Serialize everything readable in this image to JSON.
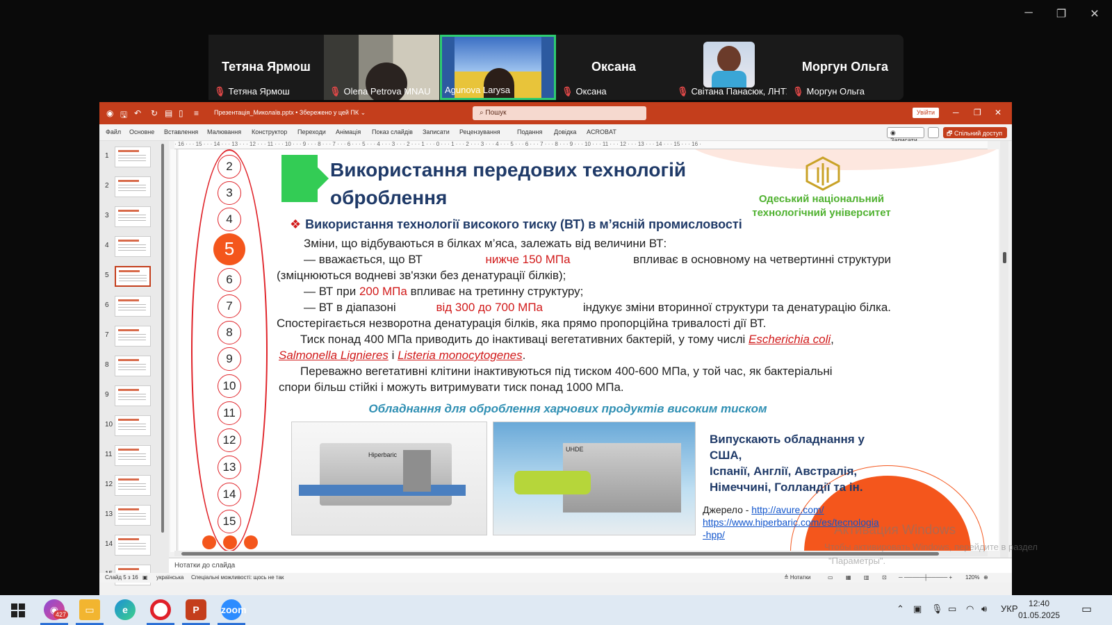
{
  "zoom": {
    "participants": [
      {
        "big_name": "Тетяна Ярмош",
        "label": "Тетяна Ярмош"
      },
      {
        "big_name": "",
        "label": "Olena Petrova MNAU"
      },
      {
        "big_name": "",
        "label": "Agunova Larysa"
      },
      {
        "big_name": "Оксана",
        "label": "Оксана"
      },
      {
        "big_name": "",
        "label": "Світана Панасюк, ЛНТУ"
      },
      {
        "big_name": "Моргун Ольга",
        "label": "Моргун Ольга"
      }
    ],
    "active_speaker_color": "#2ecc71"
  },
  "ppt": {
    "file_title": "Презентація_Миколаїв.pptx • Збережено у цей ПК ⌄",
    "search_placeholder": "Пошук",
    "login_label": "Увійти",
    "menu": [
      "Файл",
      "Основне",
      "Вставлення",
      "Малювання",
      "Конструктор",
      "Переходи",
      "Анімація",
      "Показ слайдів",
      "Записати",
      "Рецензування",
      "Подання",
      "Довідка",
      "ACROBAT"
    ],
    "record_label": "◉ Записати",
    "share_label": "🗗 Спільний доступ ⌄",
    "thumbnails": [
      "1",
      "2",
      "3",
      "4",
      "5",
      "6",
      "7",
      "8",
      "9",
      "10",
      "11",
      "12",
      "13",
      "14",
      "15"
    ],
    "selected_slide": 5,
    "ruler_text": "· 16 · · · 15 · · · 14 · · · 13 · · · 12 · · · 11 · · · 10 · · · 9 · · · 8 · · · 7 · · · 6 · · · 5 · · · 4 · · · 3 · · · 2 · · · 1 · · · 0 · · · 1 · · · 2 · · · 3 · · · 4 · · · 5 · · · 6 · · · 7 · · · 8 · · · 9 · · · 10 · · · 11 · · · 12 · · · 13 · · · 14 · · · 15 · · · 16 ·",
    "notes_placeholder": "Нотатки до слайда",
    "status": {
      "slide": "Слайд 5 з 16",
      "language": "українська",
      "accessibility": "Спеціальні можливості: щось не так",
      "notes_btn": "≜ Нотатки",
      "zoom": "120%"
    }
  },
  "slide": {
    "title_line1": "Використання передових технологій",
    "title_line2": "оброблення",
    "university_line1": "Одеський національний",
    "university_line2": "технологічний університет",
    "nav_numbers": [
      "2",
      "3",
      "4",
      "5",
      "6",
      "7",
      "8",
      "9",
      "10",
      "11",
      "12",
      "13",
      "14",
      "15"
    ],
    "active_number": "5",
    "heading": "Використання технології високого тиску (ВТ) в м’ясній промисловості",
    "p1": "Зміни, що відбуваються в білках м’яса, залежать від величини ВТ:",
    "p2a": "— вважається, що ВТ",
    "p2b": "нижче 150 МПа",
    "p2c": "впливає в основному на четвертинні структури",
    "p3": "(зміцнюються водневі зв'язки без денатурації білків);",
    "p4a": "— ВТ при",
    "p4b": "200 МПа",
    "p4c": "впливає на третинну структуру;",
    "p5a": "— ВТ в діапазоні",
    "p5b": "від 300 до 700 МПа",
    "p5c": "індукує зміни вторинної структури та денатурацію білка.",
    "p6": "Спостерігається незворотна денатурація білків, яка прямо пропорційна  тривалості дії ВТ.",
    "p7a": "Тиск понад 400 МПа приводить до інактиваці вегетативних бактерій, у тому числі",
    "p7b": "Escherichia coli",
    "p7c": ",",
    "p8a": "Salmonella Lignieres",
    "p8b": "і",
    "p8c": "Listeria monocytogenes",
    "p8d": ".",
    "p9": "Переважно вегетативні клітини інактивуються під тиском 400-600 МПа, у той час, як бактеріальні",
    "p10": "спори більш стійкі і можуть витримувати тиск понад 1000 МПа.",
    "subheading": "Обладнання для оброблення харчових продуктів високим тиском",
    "img1_label": "Hiperbaric",
    "img2_label": "UHDE",
    "produce_l1": "Випускають обладнання у",
    "produce_l2": "США,",
    "produce_l3": "Іспанії, Англії, Австралія,",
    "produce_l4": "Німеччині, Голландії та ін.",
    "source_label": "Джерело - ",
    "source_link1": "http://avure.com/",
    "source_link2": "https://www.hiperbaric.com/es/tecnologia",
    "source_link3": "-hpp/",
    "watermark1": "Активация Windows",
    "watermark2": "Чтобы активировать Windows, перейдите в раздел",
    "watermark3": "\"Параметры\"."
  },
  "taskbar": {
    "badge": "427",
    "language": "УКР",
    "time": "12:40",
    "date": "01.05.2025"
  }
}
